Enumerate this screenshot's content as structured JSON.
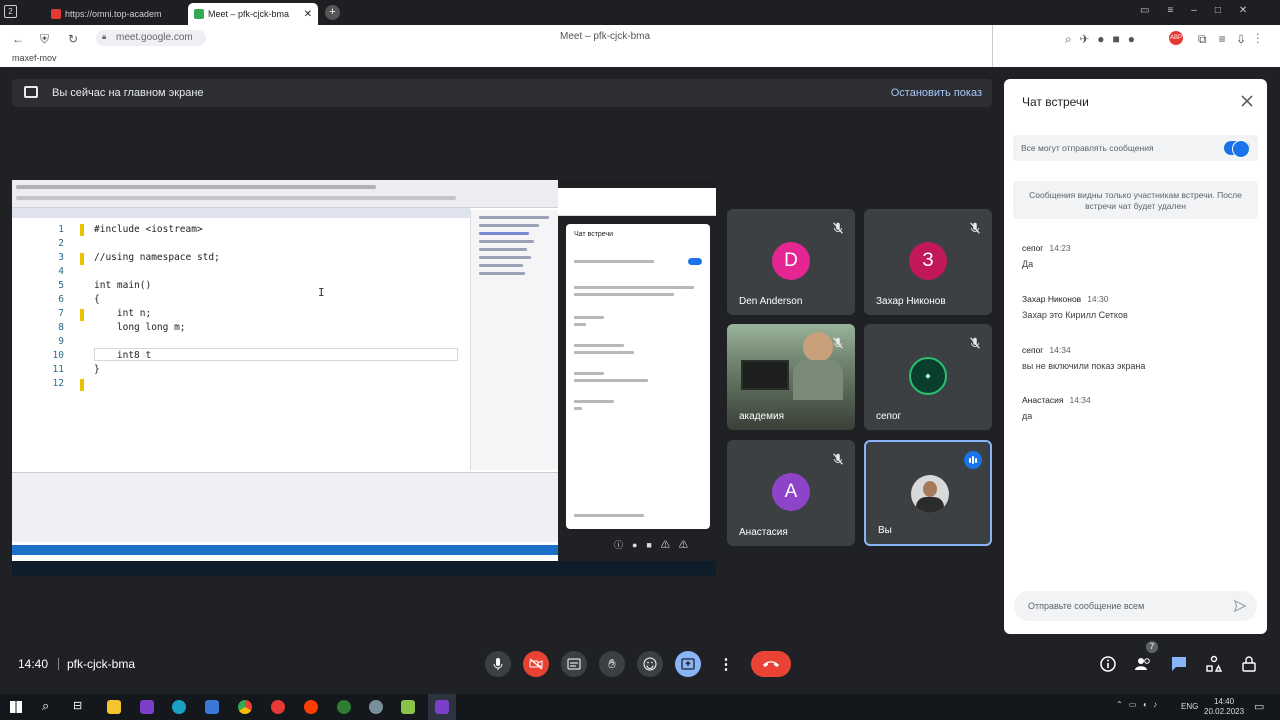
{
  "browser": {
    "tabs": [
      {
        "label": "https://omni.top-academ",
        "active": false
      },
      {
        "label": "Meet – pfk-cjck-bma",
        "active": true
      }
    ],
    "url": "meet.google.com",
    "page_title": "Meet – pfk-cjck-bma",
    "bookmark": "maxef-mov"
  },
  "presenting_bar": {
    "text": "Вы сейчас на главном экране",
    "stop_label": "Остановить показ"
  },
  "shared_code": {
    "lines": [
      {
        "n": "1",
        "text": "#include <iostream>"
      },
      {
        "n": "2",
        "text": ""
      },
      {
        "n": "3",
        "text": "//using namespace std;"
      },
      {
        "n": "4",
        "text": ""
      },
      {
        "n": "5",
        "text": "int main()"
      },
      {
        "n": "6",
        "text": "{"
      },
      {
        "n": "7",
        "text": "    int n;"
      },
      {
        "n": "8",
        "text": "    long long m;"
      },
      {
        "n": "9",
        "text": ""
      },
      {
        "n": "10",
        "text": "    int8_t"
      },
      {
        "n": "11",
        "text": "}"
      },
      {
        "n": "12",
        "text": ""
      }
    ],
    "inner_chat_title": "Чат встречи"
  },
  "participants": [
    {
      "name": "Den Anderson",
      "initial": "D",
      "color": "#e52592",
      "muted": true
    },
    {
      "name": "Захар Никонов",
      "initial": "З",
      "color": "#c2185b",
      "muted": true
    },
    {
      "name": "академия",
      "initial": "",
      "color": "",
      "muted": true,
      "video": true
    },
    {
      "name": "сепог",
      "initial": "",
      "color": "#0b3d2e",
      "muted": true
    },
    {
      "name": "Анастасия",
      "initial": "A",
      "color": "#8e44c9",
      "muted": true
    },
    {
      "name": "Вы",
      "initial": "",
      "color": "#5f6368",
      "muted": false,
      "speaking": true
    }
  ],
  "chat": {
    "title": "Чат встречи",
    "allow_label": "Все могут отправлять сообщения",
    "notice": "Сообщения видны только участникам встречи. После встречи чат будет удален",
    "messages": [
      {
        "author": "сепог",
        "time": "14:23",
        "text": "Да"
      },
      {
        "author": "Захар Никонов",
        "time": "14:30",
        "text": "Захар это Кирилл Сетков"
      },
      {
        "author": "сепог",
        "time": "14:34",
        "text": "вы не включили показ экрана"
      },
      {
        "author": "Анастасия",
        "time": "14:34",
        "text": "да"
      }
    ],
    "input_placeholder": "Отправьте сообщение всем"
  },
  "toolbar": {
    "time": "14:40",
    "meeting_code": "pfk-cjck-bma",
    "people_count": "7"
  },
  "taskbar": {
    "lang": "ENG",
    "time": "14:40",
    "date": "20.02.2023"
  },
  "colors": {
    "accent": "#1a73e8",
    "danger": "#ea4335",
    "meet_bg": "#202124"
  }
}
